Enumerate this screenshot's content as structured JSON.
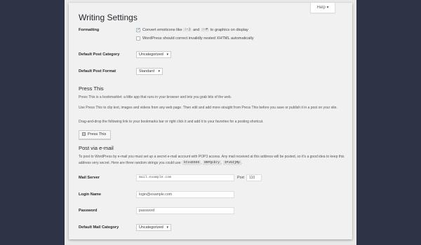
{
  "help_label": "Help ▾",
  "page_title": "Writing Settings",
  "formatting": {
    "label": "Formatting",
    "option1_pre": "Convert emoticons like",
    "code_a": ":-)",
    "and": "and",
    "code_b": ":-P",
    "option1_post": "to graphics on display",
    "option1_checked": true,
    "option2": "WordPress should correct invalidly nested XHTML automatically",
    "option2_checked": false
  },
  "default_post_category": {
    "label": "Default Post Category",
    "value": "Uncategorized"
  },
  "default_post_format": {
    "label": "Default Post Format",
    "value": "Standard"
  },
  "press_this": {
    "title": "Press This",
    "p1": "Press This is a bookmarklet: a little app that runs in your browser and lets you grab bits of the web.",
    "p2": "Use Press This to clip text, images and videos from any web page. Then edit and add more straight from Press This before you save or publish it in a post on your site.",
    "p3": "Drag-and-drop the following link to your bookmarks bar or right click it and add it to your favorites for a posting shortcut.",
    "button_label": "Press This"
  },
  "post_via_email": {
    "title": "Post via e-mail",
    "desc_pre": "To post to WordPress by e-mail you must set up a secret e-mail account with POP3 access. Any mail received at this address will be posted, so it's a good idea to keep this address very secret. Here are three random strings you could use:",
    "code1": "ktvxE5SS",
    "code2": "00FQcbry",
    "code3": "IFv5IjMp",
    "mail_server_label": "Mail Server",
    "mail_server_value": "mail.example.com",
    "port_label": "Port",
    "port_value": "110",
    "login_label": "Login Name",
    "login_placeholder": "login@example.com",
    "password_label": "Password",
    "password_placeholder": "password",
    "default_mail_category_label": "Default Mail Category",
    "default_mail_category_value": "Uncategorized"
  }
}
